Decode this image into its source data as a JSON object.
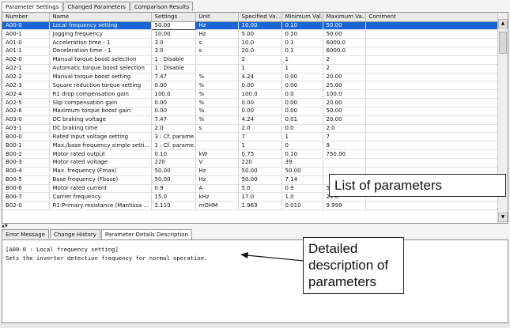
{
  "top_tabs": [
    "Parameter Settings",
    "Changed Parameters",
    "Comparison Results"
  ],
  "columns": [
    "Number",
    "Name",
    "Settings",
    "Unit",
    "Specified Va...",
    "Minimum Val...",
    "Maximum Va...",
    "Comment"
  ],
  "rows": [
    [
      "A00-0",
      "Local frequency setting",
      "50.00",
      "Hz",
      "10.00",
      "0.10",
      "50.00",
      ""
    ],
    [
      "A00-1",
      "Jogging frequency",
      "10.00",
      "Hz",
      "5.00",
      "0.10",
      "50.00",
      ""
    ],
    [
      "A01-0",
      "Acceleration time - 1",
      "3.0",
      "s",
      "10.0",
      "0.1",
      "6000.0",
      ""
    ],
    [
      "A01-1",
      "Deceleration time - 1",
      "3.0",
      "s",
      "20.0",
      "0.1",
      "6000.0",
      ""
    ],
    [
      "A02-0",
      "Manual torque boost selection",
      "1 : Disable",
      "",
      "2",
      "1",
      "2",
      ""
    ],
    [
      "A02-1",
      "Automatic torque boost selection",
      "1 : Disable",
      "",
      "1",
      "1",
      "2",
      ""
    ],
    [
      "A02-2",
      "Manual torque boost setting",
      "7.47",
      "%",
      "4.24",
      "0.00",
      "20.00",
      ""
    ],
    [
      "A02-3",
      "Square reduction torque setting",
      "0.00",
      "%",
      "0.00",
      "0.00",
      "25.00",
      ""
    ],
    [
      "A02-4",
      "R1 drop compensation gain",
      "100.0",
      "%",
      "100.0",
      "0.0",
      "100.0",
      ""
    ],
    [
      "A02-5",
      "Slip compensation gain",
      "0.00",
      "%",
      "0.00",
      "0.00",
      "20.00",
      ""
    ],
    [
      "A02-6",
      "Maximum torque boost gain",
      "0.00",
      "%",
      "0.00",
      "0.00",
      "50.00",
      ""
    ],
    [
      "A03-0",
      "DC braking voltage",
      "7.47",
      "%",
      "4.24",
      "0.01",
      "20.00",
      ""
    ],
    [
      "A03-1",
      "DC braking time",
      "2.0",
      "s",
      "2.0",
      "0.0",
      "2.0",
      ""
    ],
    [
      "B00-0",
      "Rated input voltage setting",
      "3 : Cf. parame...",
      "",
      "7",
      "1",
      "7",
      ""
    ],
    [
      "B00-1",
      "Max./base frequency simple setti...",
      "1 : Cf. parame...",
      "",
      "1",
      "0",
      "9",
      ""
    ],
    [
      "B00-2",
      "Motor rated output",
      "0.10",
      "kW",
      "0.75",
      "0.10",
      "750.00",
      ""
    ],
    [
      "B00-3",
      "Motor rated voltage",
      "220",
      "V",
      "220",
      "39",
      "",
      ""
    ],
    [
      "B00-4",
      "Max. frequency (Fmax)",
      "50.00",
      "Hz",
      "50.00",
      "50.00",
      "",
      ""
    ],
    [
      "B00-5",
      "Base frequency (Fbase)",
      "50.00",
      "Hz",
      "50.00",
      "7.14",
      "",
      ""
    ],
    [
      "B00-6",
      "Motor rated current",
      "0.9",
      "A",
      "5.0",
      "0.9",
      "5.0",
      ""
    ],
    [
      "B00-7",
      "Carrier frequency",
      "15.0",
      "kHz",
      "17.0",
      "1.0",
      "21.0",
      ""
    ],
    [
      "B02-0",
      "R1:Primary resistance (Mantissa ...",
      "2.110",
      "mOHM",
      "1.963",
      "0.010",
      "9.999",
      ""
    ]
  ],
  "bottom_tabs": [
    "Error Message",
    "Change History",
    "Parameter Details Description"
  ],
  "description": {
    "line1": "[A00-0 : Local frequency setting]",
    "line2": "Sets the inverter detection frequency for normal operation."
  },
  "callouts": {
    "list": "List of parameters",
    "detail_1": "Detailed",
    "detail_2": "description of",
    "detail_3": "parameters"
  },
  "scroll_icons": {
    "up": "▲",
    "down": "▼",
    "split": "▲▼"
  },
  "colors": {
    "selection": "#1a66d6"
  }
}
